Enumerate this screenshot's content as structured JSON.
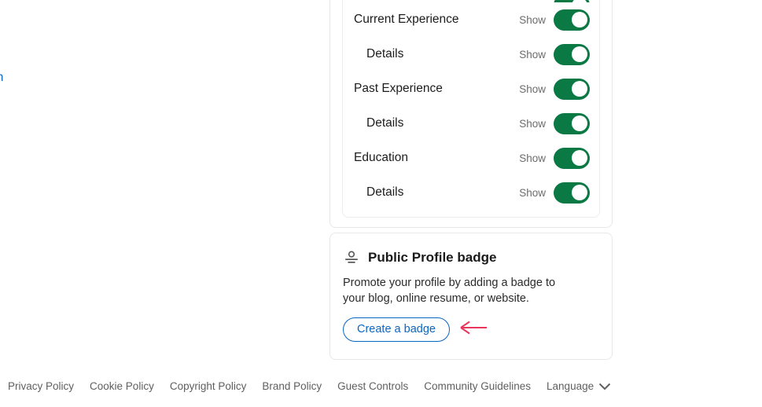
{
  "page": {
    "left_fragment_text": "in"
  },
  "visibility_card": {
    "rows": [
      {
        "label": "",
        "state": "",
        "indented": false,
        "partial": true,
        "toggle_on": true
      },
      {
        "label": "Current Experience",
        "state": "Show",
        "indented": false,
        "partial": false,
        "toggle_on": true
      },
      {
        "label": "Details",
        "state": "Show",
        "indented": true,
        "partial": false,
        "toggle_on": true
      },
      {
        "label": "Past Experience",
        "state": "Show",
        "indented": false,
        "partial": false,
        "toggle_on": true
      },
      {
        "label": "Details",
        "state": "Show",
        "indented": true,
        "partial": false,
        "toggle_on": true
      },
      {
        "label": "Education",
        "state": "Show",
        "indented": false,
        "partial": false,
        "toggle_on": true
      },
      {
        "label": "Details",
        "state": "Show",
        "indented": true,
        "partial": false,
        "toggle_on": true
      }
    ]
  },
  "badge_card": {
    "icon_name": "public-profile-badge-icon",
    "title": "Public Profile badge",
    "description": "Promote your profile by adding a badge to your blog, online resume, or website.",
    "button_label": "Create a badge",
    "annotation_arrow": {
      "name": "pointer-arrow",
      "direction": "left",
      "color": "#e8365d"
    }
  },
  "footer": {
    "links": [
      "Privacy Policy",
      "Cookie Policy",
      "Copyright Policy",
      "Brand Policy",
      "Guest Controls",
      "Community Guidelines"
    ],
    "language": {
      "label": "Language",
      "icon": "chevron-down-icon"
    }
  },
  "colors": {
    "toggle_on": "#0a7943",
    "link_blue": "#0a66c2",
    "arrow": "#e8365d",
    "card_border": "#e8e8e8",
    "footer_text": "#5f5f5f"
  }
}
